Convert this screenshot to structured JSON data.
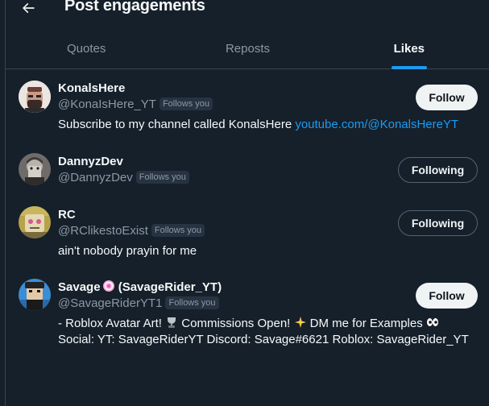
{
  "header": {
    "title": "Post engagements"
  },
  "tabs": [
    {
      "label": "Quotes",
      "active": false
    },
    {
      "label": "Reposts",
      "active": false
    },
    {
      "label": "Likes",
      "active": true
    }
  ],
  "users": [
    {
      "name": "KonalsHere",
      "handle": "@KonaIsHere_YT",
      "follows_badge": "Follows you",
      "bio_text": "Subscribe to my channel called KonalsHere ",
      "bio_link": "youtube.com/@KonalsHereYT",
      "button": "Follow"
    },
    {
      "name": "DannyzDev",
      "handle": "@DannyzDev",
      "follows_badge": "Follows you",
      "button": "Following"
    },
    {
      "name": "RC",
      "handle": "@RClikestoExist",
      "follows_badge": "Follows you",
      "bio_text": "ain't nobody prayin for me",
      "button": "Following"
    },
    {
      "name_part1": "Savage",
      "name_part2": " (SavageRider_YT)",
      "handle": "@SavageRiderYT1",
      "follows_badge": "Follows you",
      "bio_line1_a": "- Roblox Avatar Art! ",
      "bio_line1_b": " Commissions Open! ",
      "bio_line1_c": " DM me for Examples ",
      "bio_line2": "Social: YT: SavageRiderYT Discord: Savage#6621 Roblox: SavageRider_YT",
      "button": "Follow"
    }
  ],
  "colors": {
    "background": "#15202b",
    "accent": "#1d9bf0",
    "muted": "#8b98a5"
  }
}
